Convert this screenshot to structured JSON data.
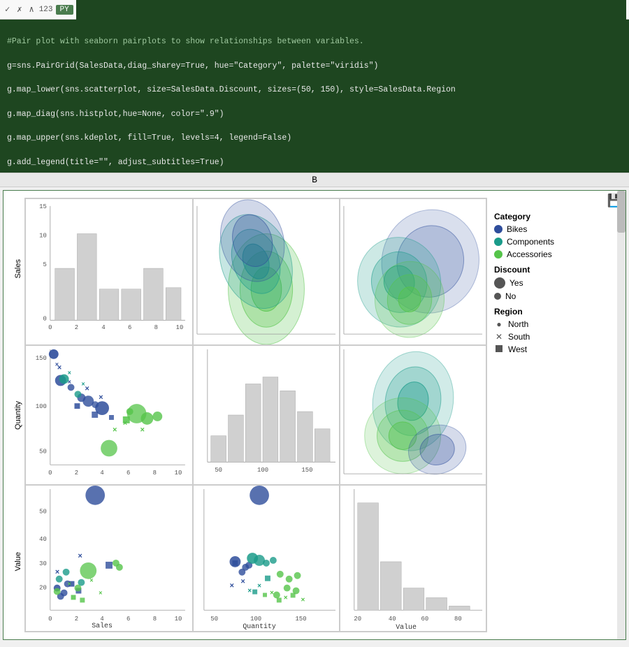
{
  "toolbar": {
    "check_icon": "✓",
    "x_icon": "✗",
    "chevron_icon": "∧",
    "cell_num": "123",
    "lang_badge": "PY"
  },
  "code": {
    "line1": "#Pair plot with seaborn pairplots to show relationships between variables.",
    "line2": "g=sns.PairGrid(SalesData,diag_sharey=True, hue=\"Category\", palette=\"viridis\")",
    "line3": "g.map_lower(sns.scatterplot, size=SalesData.Discount, sizes=(50, 150), style=SalesData.Region",
    "line4": "g.map_diag(sns.histplot,hue=None, color=\".9\")",
    "line5": "g.map_upper(sns.kdeplot, fill=True, levels=4, legend=False)",
    "line6": "g.add_legend(title=\"\", adjust_subtitles=True)"
  },
  "output_bar": {
    "label": "B"
  },
  "legend": {
    "category_title": "Category",
    "bikes_label": "Bikes",
    "components_label": "Components",
    "accessories_label": "Accessories",
    "discount_title": "Discount",
    "yes_label": "Yes",
    "no_label": "No",
    "region_title": "Region",
    "north_label": "North",
    "south_label": "South",
    "west_label": "West",
    "colors": {
      "bikes": "#2e4d9b",
      "components": "#1a9b8a",
      "accessories": "#55c44a"
    }
  },
  "axes": {
    "sales_ticks_y": [
      "15",
      "10",
      "5",
      "0"
    ],
    "quantity_ticks_y": [
      "150",
      "100",
      "50"
    ],
    "value_ticks_y": [
      "50",
      "40",
      "30",
      "20"
    ],
    "sales_ticks_x": [
      "0",
      "2",
      "4",
      "6",
      "8",
      "10"
    ],
    "quantity_ticks_x": [
      "50",
      "100",
      "150"
    ],
    "value_ticks_x": [
      "20",
      "40",
      "60",
      "80"
    ]
  }
}
